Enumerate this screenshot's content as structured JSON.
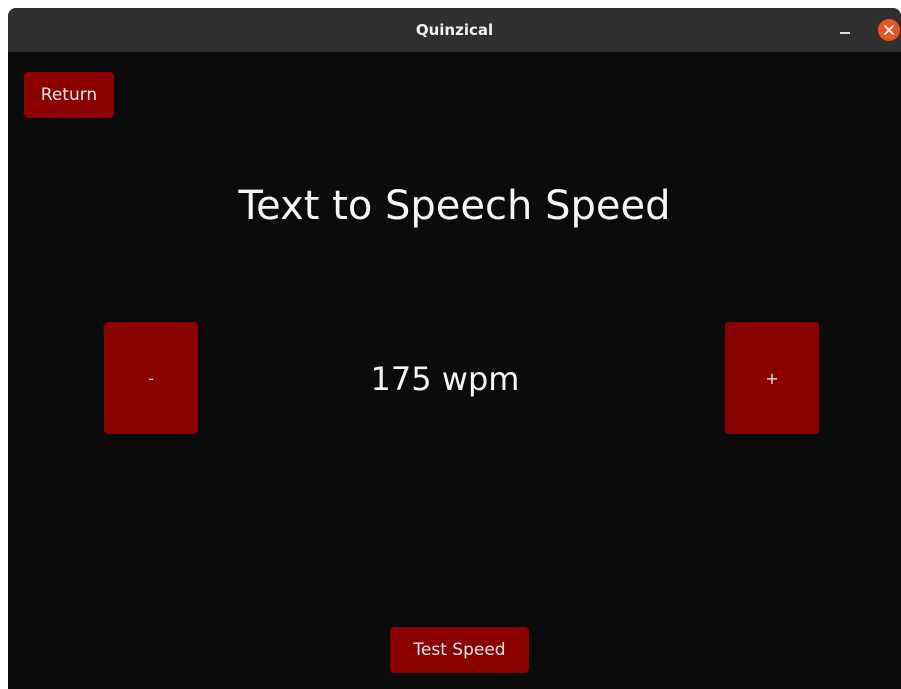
{
  "window": {
    "title": "Quinzical"
  },
  "toolbar": {
    "return_label": "Return"
  },
  "main": {
    "heading": "Text to Speech Speed",
    "decrease_label": "-",
    "increase_label": "+",
    "speed_display": "175 wpm",
    "test_label": "Test Speed"
  },
  "icons": {
    "minimize": "minimize-icon",
    "close": "close-icon"
  },
  "colors": {
    "background": "#0b0b0b",
    "titlebar": "#2f2f2f",
    "button": "#8b0000",
    "close_accent": "#e95420",
    "text": "#f5f5f5"
  }
}
